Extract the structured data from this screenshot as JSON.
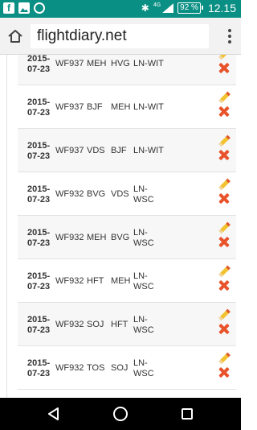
{
  "status_bar": {
    "left_icons": [
      "facebook-icon",
      "gallery-icon",
      "circle-notification-icon"
    ],
    "network": "4G",
    "battery": "92 %",
    "time": "12.15"
  },
  "browser": {
    "url": "flightdiary.net"
  },
  "flights": [
    {
      "date_line1": "2015-",
      "date_line2": "07-23",
      "flight": "WF937",
      "from": "MEH",
      "to": "HVG",
      "reg_line1": "LN-WIT",
      "reg_line2": ""
    },
    {
      "date_line1": "2015-",
      "date_line2": "07-23",
      "flight": "WF937",
      "from": "BJF",
      "to": "MEH",
      "reg_line1": "LN-WIT",
      "reg_line2": ""
    },
    {
      "date_line1": "2015-",
      "date_line2": "07-23",
      "flight": "WF937",
      "from": "VDS",
      "to": "BJF",
      "reg_line1": "LN-WIT",
      "reg_line2": ""
    },
    {
      "date_line1": "2015-",
      "date_line2": "07-23",
      "flight": "WF932",
      "from": "BVG",
      "to": "VDS",
      "reg_line1": "LN-",
      "reg_line2": "WSC"
    },
    {
      "date_line1": "2015-",
      "date_line2": "07-23",
      "flight": "WF932",
      "from": "MEH",
      "to": "BVG",
      "reg_line1": "LN-",
      "reg_line2": "WSC"
    },
    {
      "date_line1": "2015-",
      "date_line2": "07-23",
      "flight": "WF932",
      "from": "HFT",
      "to": "MEH",
      "reg_line1": "LN-",
      "reg_line2": "WSC"
    },
    {
      "date_line1": "2015-",
      "date_line2": "07-23",
      "flight": "WF932",
      "from": "SOJ",
      "to": "HFT",
      "reg_line1": "LN-",
      "reg_line2": "WSC"
    },
    {
      "date_line1": "2015-",
      "date_line2": "07-23",
      "flight": "WF932",
      "from": "TOS",
      "to": "SOJ",
      "reg_line1": "LN-",
      "reg_line2": "WSC"
    }
  ],
  "colors": {
    "status_bar": "#0a8f84",
    "delete_icon": "#e8532b",
    "edit_icon": "#f2c230"
  }
}
